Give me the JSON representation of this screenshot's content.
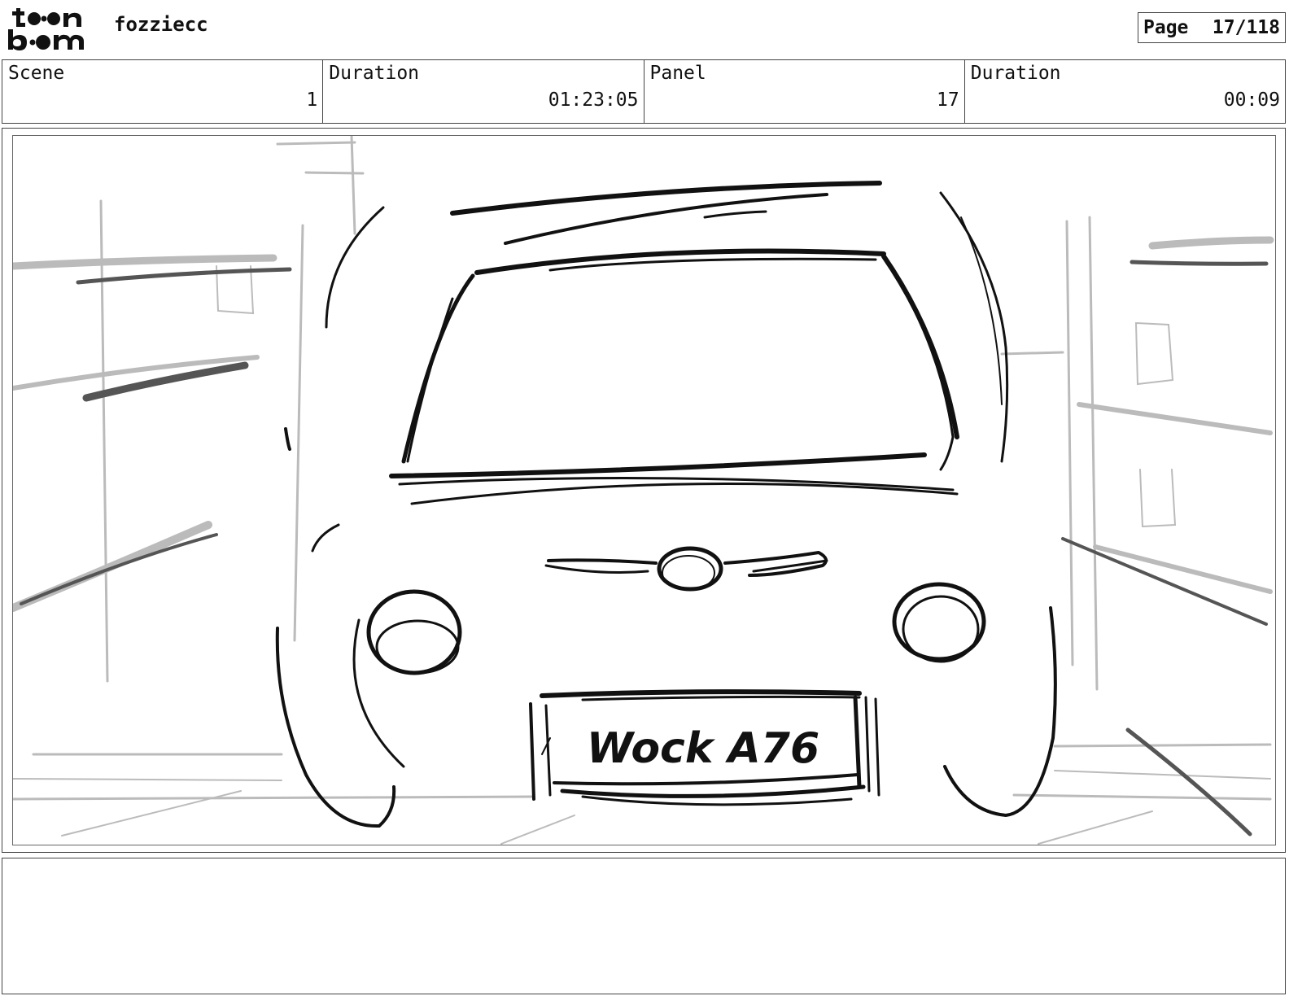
{
  "header": {
    "project_name": "fozziecc",
    "page_label": "Page",
    "page_value": "17/118"
  },
  "info": {
    "scene_label": "Scene",
    "scene_value": "1",
    "scene_duration_label": "Duration",
    "scene_duration_value": "01:23:05",
    "panel_label": "Panel",
    "panel_value": "17",
    "panel_duration_label": "Duration",
    "panel_duration_value": "00:09"
  },
  "panel": {
    "license_plate_text": "Wock A76"
  },
  "notes": {}
}
